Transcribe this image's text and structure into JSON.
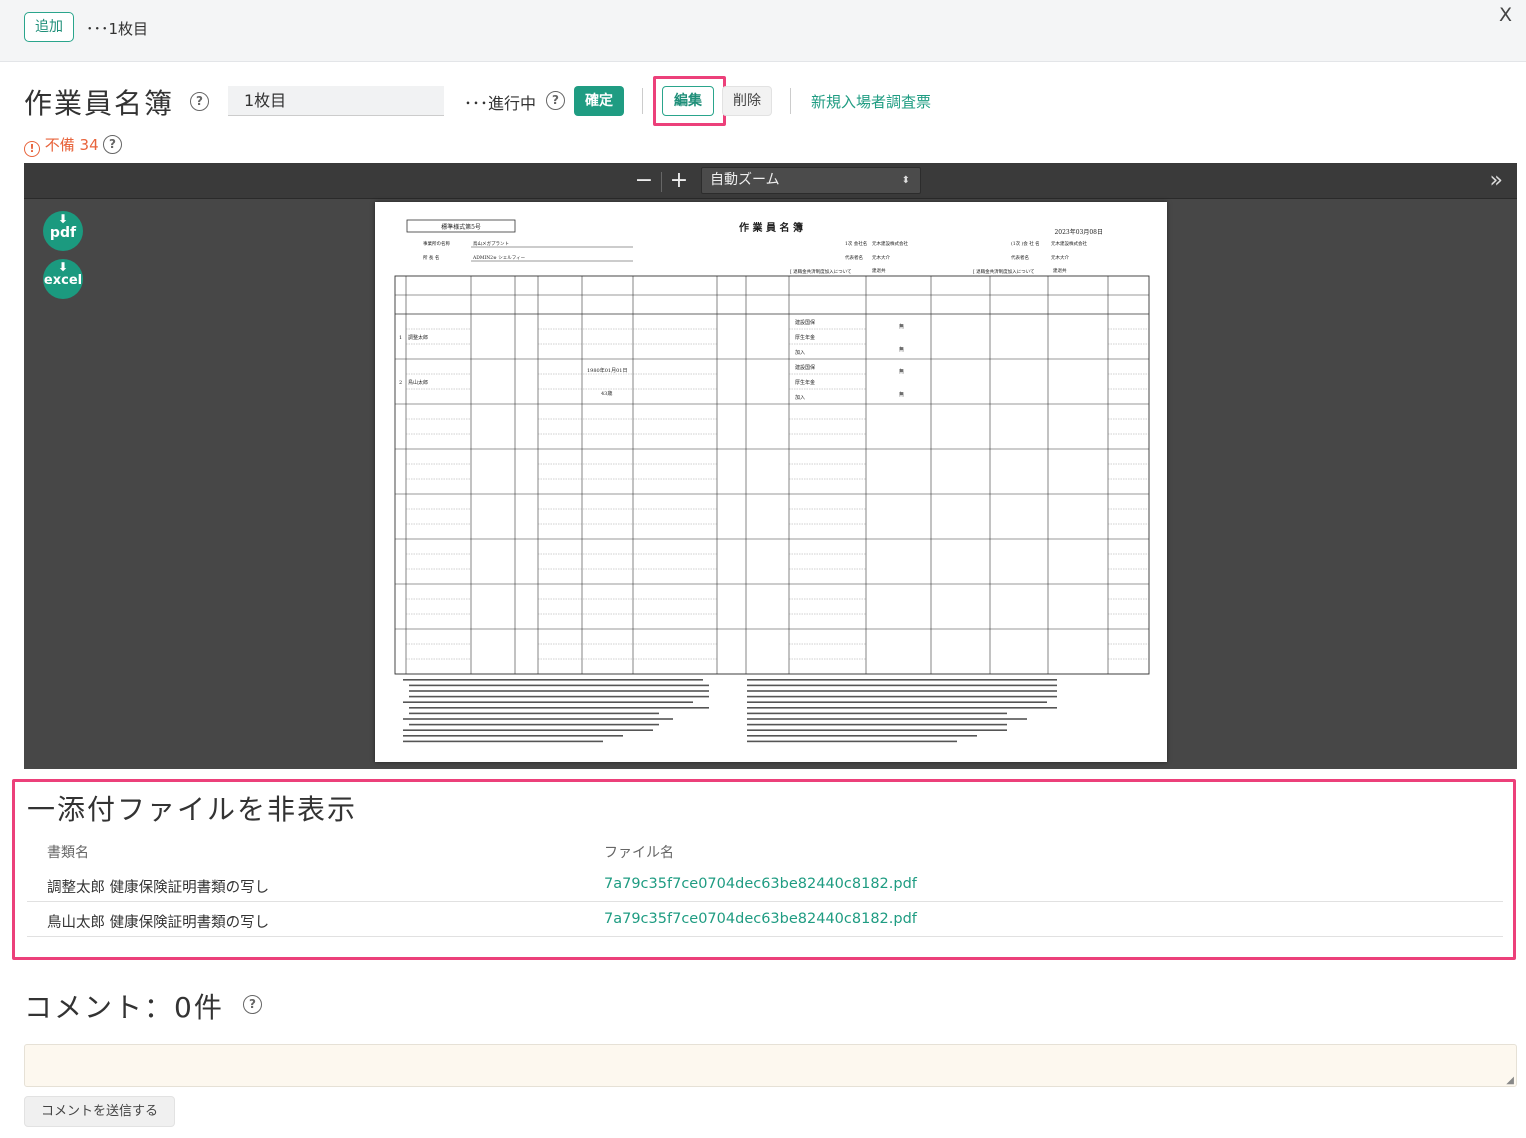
{
  "topbar": {
    "add_label": "追加",
    "crumb": "･･･1枚目",
    "close": "X"
  },
  "header": {
    "title": "作業員名簿",
    "sheet_value": "1枚目",
    "status": "･･･進行中",
    "confirm_label": "確定",
    "edit_label": "編集",
    "delete_label": "削除",
    "new_survey_link": "新規入場者調査票"
  },
  "warning": {
    "icon": "!",
    "text": "不備 34"
  },
  "help_glyph": "?",
  "viewer": {
    "minus": "−",
    "plus": "+",
    "zoom_value": "自動ズーム",
    "zoom_arrows": "⬍",
    "sidebar_toggle": "»",
    "pdf_label": "pdf",
    "excel_label": "excel",
    "download_arrow": "⬇"
  },
  "document": {
    "form_no": "標準様式第5号",
    "title": "作 業 員 名 簿",
    "date": "2023年03月08日",
    "site_label": "事業所の名称",
    "site_value": "鳥山メガプラント",
    "manager_label": "所 長 名",
    "manager_value": "ADMIN2※ シェルフィー",
    "company_label": "1次 会社名",
    "company_value": "元木建設株式会社",
    "company_label2": "(1次 )会 社 名",
    "company_value2": "元木建設株式会社",
    "rep_label": "代表者名",
    "rep_value": "元木大介",
    "pension_note": "[ 退職金共済制度加入について",
    "pension_value": "建退共",
    "rows": [
      {
        "no": "1",
        "name": "調整太郎",
        "ins1": "建設国保",
        "ins2": "厚生年金",
        "ins3": "加入",
        "v1": "無",
        "v2": "無"
      },
      {
        "no": "2",
        "name": "鳥山太郎",
        "birth": "1980年01月01日",
        "age": "43歳",
        "ins1": "建設国保",
        "ins2": "厚生年金",
        "ins3": "加入",
        "v1": "無",
        "v2": "無"
      }
    ]
  },
  "attachments": {
    "title": "一添付ファイルを非表示",
    "col_doc": "書類名",
    "col_file": "ファイル名",
    "rows": [
      {
        "doc": "調整太郎 健康保険証明書類の写し",
        "file": "7a79c35f7ce0704dec63be82440c8182.pdf"
      },
      {
        "doc": "鳥山太郎 健康保険証明書類の写し",
        "file": "7a79c35f7ce0704dec63be82440c8182.pdf"
      }
    ]
  },
  "comments": {
    "title": "コメント：0件",
    "send_label": "コメントを送信する"
  },
  "colors": {
    "accent": "#1f9c82",
    "highlight": "#ec407a",
    "warning": "#e8643c"
  }
}
